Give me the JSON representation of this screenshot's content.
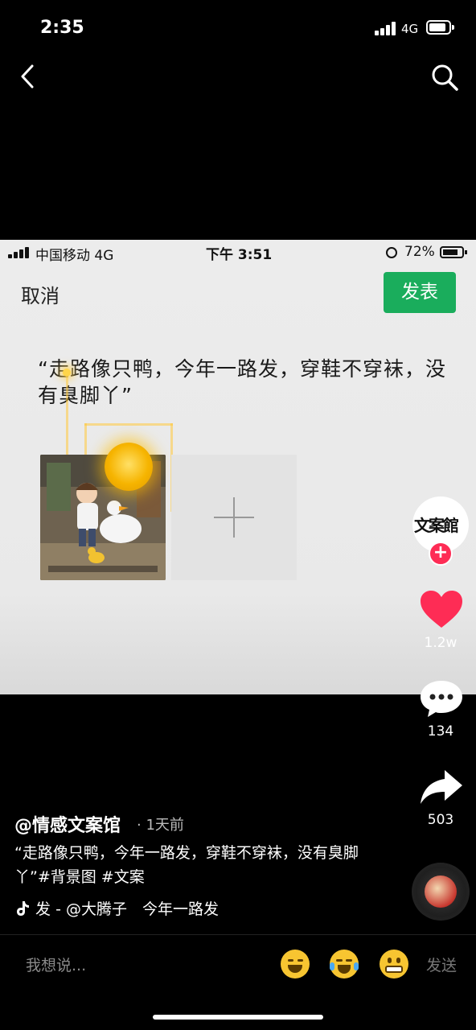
{
  "status_bar": {
    "time": "2:35",
    "network": "4G"
  },
  "nav": {
    "back_icon": "chevron-left-icon",
    "search_icon": "search-icon"
  },
  "video": {
    "inner_status": {
      "carrier": "中国移动 4G",
      "time": "下午 3:51",
      "battery": "72%"
    },
    "cancel_label": "取消",
    "post_label": "发表",
    "post_color": "#1aad5c",
    "quote_text": "“走路像只鸭，今年一路发，穿鞋不穿袜，没有臭脚丫”",
    "add_icon": "plus-icon"
  },
  "right_rail": {
    "avatar_logo": "文案館",
    "follow_icon": "plus-icon",
    "like_count": "1.2w",
    "comment_count": "134",
    "share_count": "503",
    "like_color": "#fe2c55"
  },
  "post": {
    "author": "@情感文案馆",
    "meta": "· 1天前",
    "caption": "“走路像只鸭，今年一路发，穿鞋不穿袜，没有臭脚丫”#背景图 #文案",
    "music": "发 - @大腾子　今年一路发"
  },
  "comment_bar": {
    "placeholder": "我想说...",
    "send_label": "发送",
    "emojis": [
      "laughing-tears-emoji",
      "crying-laughing-emoji",
      "grinning-emoji"
    ]
  }
}
